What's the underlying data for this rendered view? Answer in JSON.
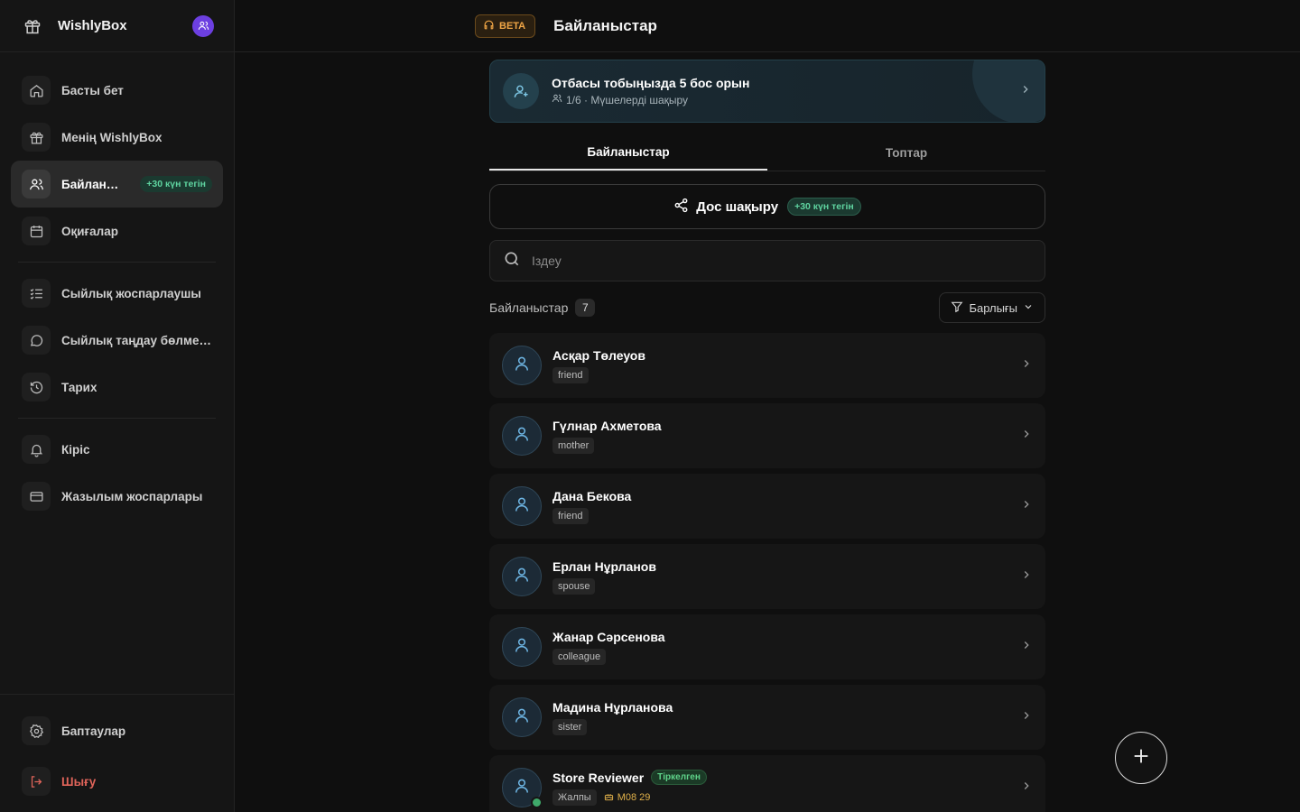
{
  "app": {
    "name": "WishlyBox"
  },
  "header": {
    "beta_label": "BETA",
    "title": "Байланыстар"
  },
  "sidebar": {
    "items": [
      {
        "label": "Басты бет",
        "icon": "home-icon"
      },
      {
        "label": "Менің WishlyBox",
        "icon": "gift-icon"
      },
      {
        "label": "Байланыстар",
        "icon": "users-icon",
        "badge": "+30 күн тегін",
        "active": true
      },
      {
        "label": "Оқиғалар",
        "icon": "calendar-icon"
      },
      {
        "label": "Сыйлық жоспарлаушы",
        "icon": "checklist-icon"
      },
      {
        "label": "Сыйлық таңдау бөлмелері",
        "icon": "chat-icon"
      },
      {
        "label": "Тарих",
        "icon": "history-icon"
      },
      {
        "label": "Кіріс",
        "icon": "bell-icon"
      },
      {
        "label": "Жазылым жоспарлары",
        "icon": "card-icon"
      }
    ],
    "bottom": [
      {
        "label": "Баптаулар",
        "icon": "gear-icon"
      },
      {
        "label": "Шығу",
        "icon": "logout-icon"
      }
    ]
  },
  "family": {
    "title": "Отбасы тобыңызда 5 бос орын",
    "subtitle": "1/6 · Мүшелерді шақыру"
  },
  "tabs": [
    {
      "label": "Байланыстар",
      "active": true
    },
    {
      "label": "Топтар",
      "active": false
    }
  ],
  "invite": {
    "label": "Дос шақыру",
    "badge": "+30 күн тегін"
  },
  "search": {
    "placeholder": "Іздеу"
  },
  "list": {
    "title": "Байланыстар",
    "count": "7",
    "filter_label": "Барлығы"
  },
  "contacts": [
    {
      "name": "Асқар Төлеуов",
      "relation": "friend"
    },
    {
      "name": "Гүлнар Ахметова",
      "relation": "mother"
    },
    {
      "name": "Дана Бекова",
      "relation": "friend"
    },
    {
      "name": "Ерлан Нұрланов",
      "relation": "spouse"
    },
    {
      "name": "Жанар Сәрсенова",
      "relation": "colleague"
    },
    {
      "name": "Мадина Нұрланова",
      "relation": "sister"
    },
    {
      "name": "Store Reviewer",
      "relation": "Жалпы",
      "badge": "Тіркелген",
      "date": "M08 29",
      "online": true
    }
  ],
  "colors": {
    "accent_green": "#5fd4a0",
    "beta_orange": "#f0a646",
    "logout_red": "#e0645a",
    "brand_purple": "#6c3fe0"
  }
}
